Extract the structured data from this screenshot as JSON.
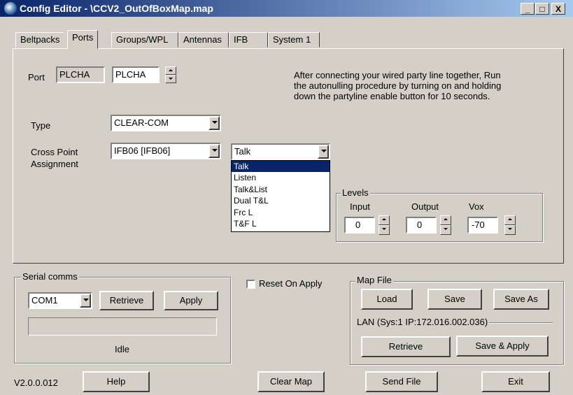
{
  "window": {
    "title": "Config Editor - \\CCV2_OutOfBoxMap.map",
    "minimize": "_",
    "maximize": "□",
    "close": "X"
  },
  "tabs": [
    "Beltpacks",
    "Ports",
    "Groups/WPL",
    "Antennas",
    "IFB",
    "System 1"
  ],
  "active_tab": "Ports",
  "port": {
    "label": "Port",
    "name_readonly": "PLCHA",
    "name_value": "PLCHA"
  },
  "instructions": "After connecting your wired party line together, Run the autonulling procedure by turning on and holding down the partyline enable button for 10 seconds.",
  "type": {
    "label": "Type",
    "value": "CLEAR-COM"
  },
  "cross_point": {
    "label_line1": "Cross Point",
    "label_line2": "Assignment",
    "value": "IFB06  [IFB06]",
    "mode_value": "Talk",
    "mode_options": [
      "Talk",
      "Listen",
      "Talk&List",
      "Dual T&L",
      "Frc L",
      "T&F L"
    ],
    "mode_selected": "Talk"
  },
  "levels": {
    "title": "Levels",
    "input_label": "Input",
    "input_value": "0",
    "output_label": "Output",
    "output_value": "0",
    "vox_label": "Vox",
    "vox_value": "-70"
  },
  "serial": {
    "title": "Serial comms",
    "port_value": "COM1",
    "retrieve": "Retrieve",
    "apply": "Apply",
    "status": "Idle"
  },
  "reset_on_apply": "Reset On Apply",
  "map_file": {
    "title": "Map File",
    "load": "Load",
    "save": "Save",
    "save_as": "Save As",
    "lan_label": "LAN  (Sys:1 IP:172.016.002.036)",
    "retrieve": "Retrieve",
    "save_apply": "Save & Apply"
  },
  "footer": {
    "version": "V2.0.0.012",
    "help": "Help",
    "clear_map": "Clear Map",
    "send_file": "Send File",
    "exit": "Exit"
  }
}
